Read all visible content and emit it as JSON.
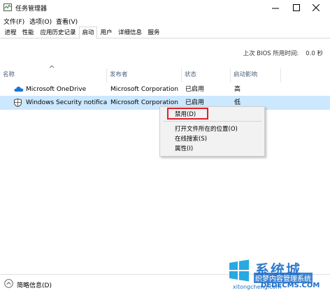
{
  "window": {
    "title": "任务管理器"
  },
  "menu": [
    "文件(F)",
    "选项(O)",
    "查看(V)"
  ],
  "tabs": [
    {
      "label": "进程",
      "active": false
    },
    {
      "label": "性能",
      "active": false
    },
    {
      "label": "应用历史记录",
      "active": false
    },
    {
      "label": "启动",
      "active": true
    },
    {
      "label": "用户",
      "active": false
    },
    {
      "label": "详细信息",
      "active": false
    },
    {
      "label": "服务",
      "active": false
    }
  ],
  "boot_time": {
    "label": "上次 BIOS 所用时间:",
    "value": "0.0 秒"
  },
  "columns": [
    "名称",
    "发布者",
    "状态",
    "启动影响"
  ],
  "rows": [
    {
      "name": "Microsoft OneDrive",
      "publisher": "Microsoft Corporation",
      "status": "已启用",
      "impact": "高",
      "icon": "cloud-icon",
      "selected": false
    },
    {
      "name": "Windows Security notifica...",
      "publisher": "Microsoft Corporation",
      "status": "已启用",
      "impact": "低",
      "icon": "shield-icon",
      "selected": true
    }
  ],
  "context_menu": {
    "items": [
      "禁用(D)",
      "打开文件所在的位置(O)",
      "在线搜索(S)",
      "属性(I)"
    ]
  },
  "footer": {
    "label": "简略信息(D)",
    "icon": "chevron-up-circle-icon"
  },
  "watermark": {
    "title": "系统城",
    "subtitle": "织梦内容管理系统",
    "url1": "DEDECMS.COM",
    "url2": "xitongcheng.com"
  },
  "colors": {
    "selected_row": "#cce8ff",
    "highlight": "#e0202a",
    "header_text": "#4c607a",
    "accent": "#1e6fc8"
  }
}
